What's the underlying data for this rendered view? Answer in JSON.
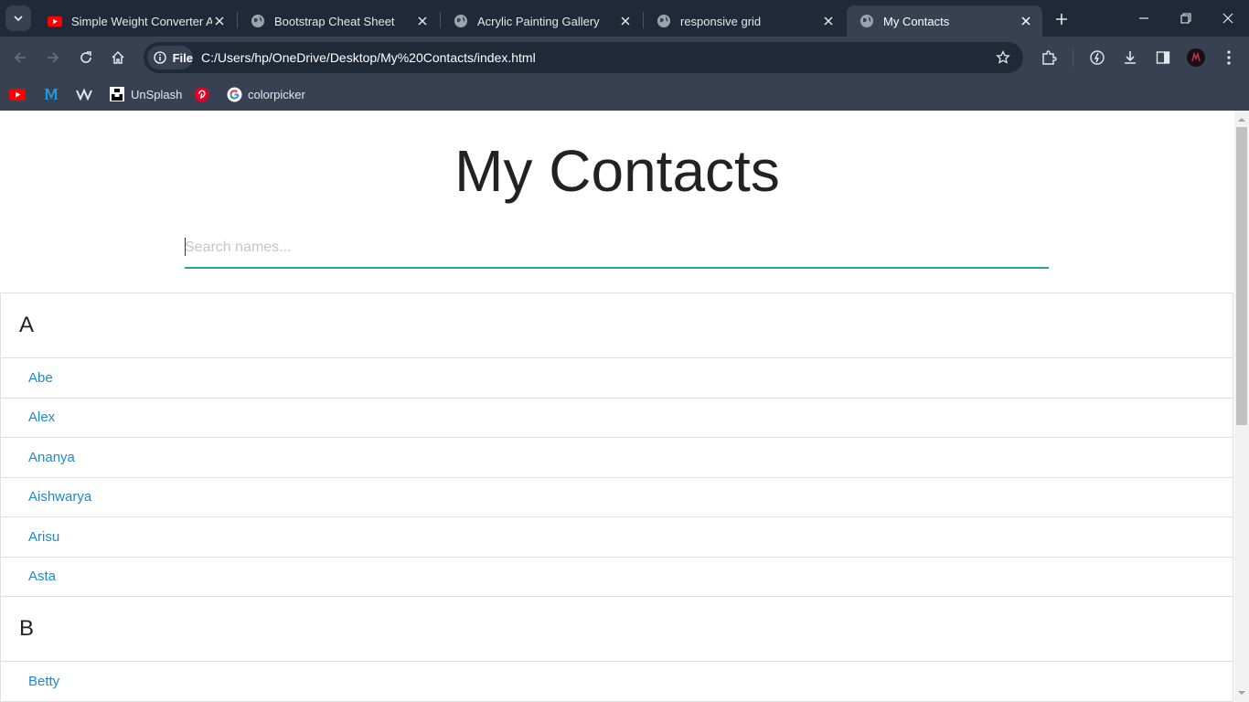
{
  "tabs": [
    {
      "title": "Simple Weight Converter Ap",
      "icon": "youtube-icon",
      "active": false
    },
    {
      "title": "Bootstrap Cheat Sheet",
      "icon": "globe-icon",
      "active": false
    },
    {
      "title": "Acrylic Painting Gallery",
      "icon": "globe-icon",
      "active": false
    },
    {
      "title": "responsive grid",
      "icon": "globe-icon",
      "active": false
    },
    {
      "title": "My Contacts",
      "icon": "globe-icon",
      "active": true
    }
  ],
  "address_bar": {
    "chip_label": "File",
    "url": "C:/Users/hp/OneDrive/Desktop/My%20Contacts/index.html"
  },
  "bookmarks": [
    {
      "label": "",
      "icon": "youtube-icon"
    },
    {
      "label": "",
      "icon": "medium-icon"
    },
    {
      "label": "",
      "icon": "webflow-icon"
    },
    {
      "label": "UnSplash",
      "icon": "unsplash-icon"
    },
    {
      "label": "",
      "icon": "pinterest-icon"
    },
    {
      "label": "colorpicker",
      "icon": "google-icon"
    }
  ],
  "page": {
    "title": "My Contacts",
    "search_placeholder": "Search names...",
    "groups": [
      {
        "letter": "A",
        "contacts": [
          "Abe",
          "Alex",
          "Ananya",
          "Aishwarya",
          "Arisu",
          "Asta"
        ]
      },
      {
        "letter": "B",
        "contacts": [
          "Betty"
        ]
      }
    ]
  },
  "colors": {
    "accent": "#26a69a",
    "link": "#1e88c9",
    "chrome_dark": "#1f2937",
    "chrome": "#374151"
  }
}
